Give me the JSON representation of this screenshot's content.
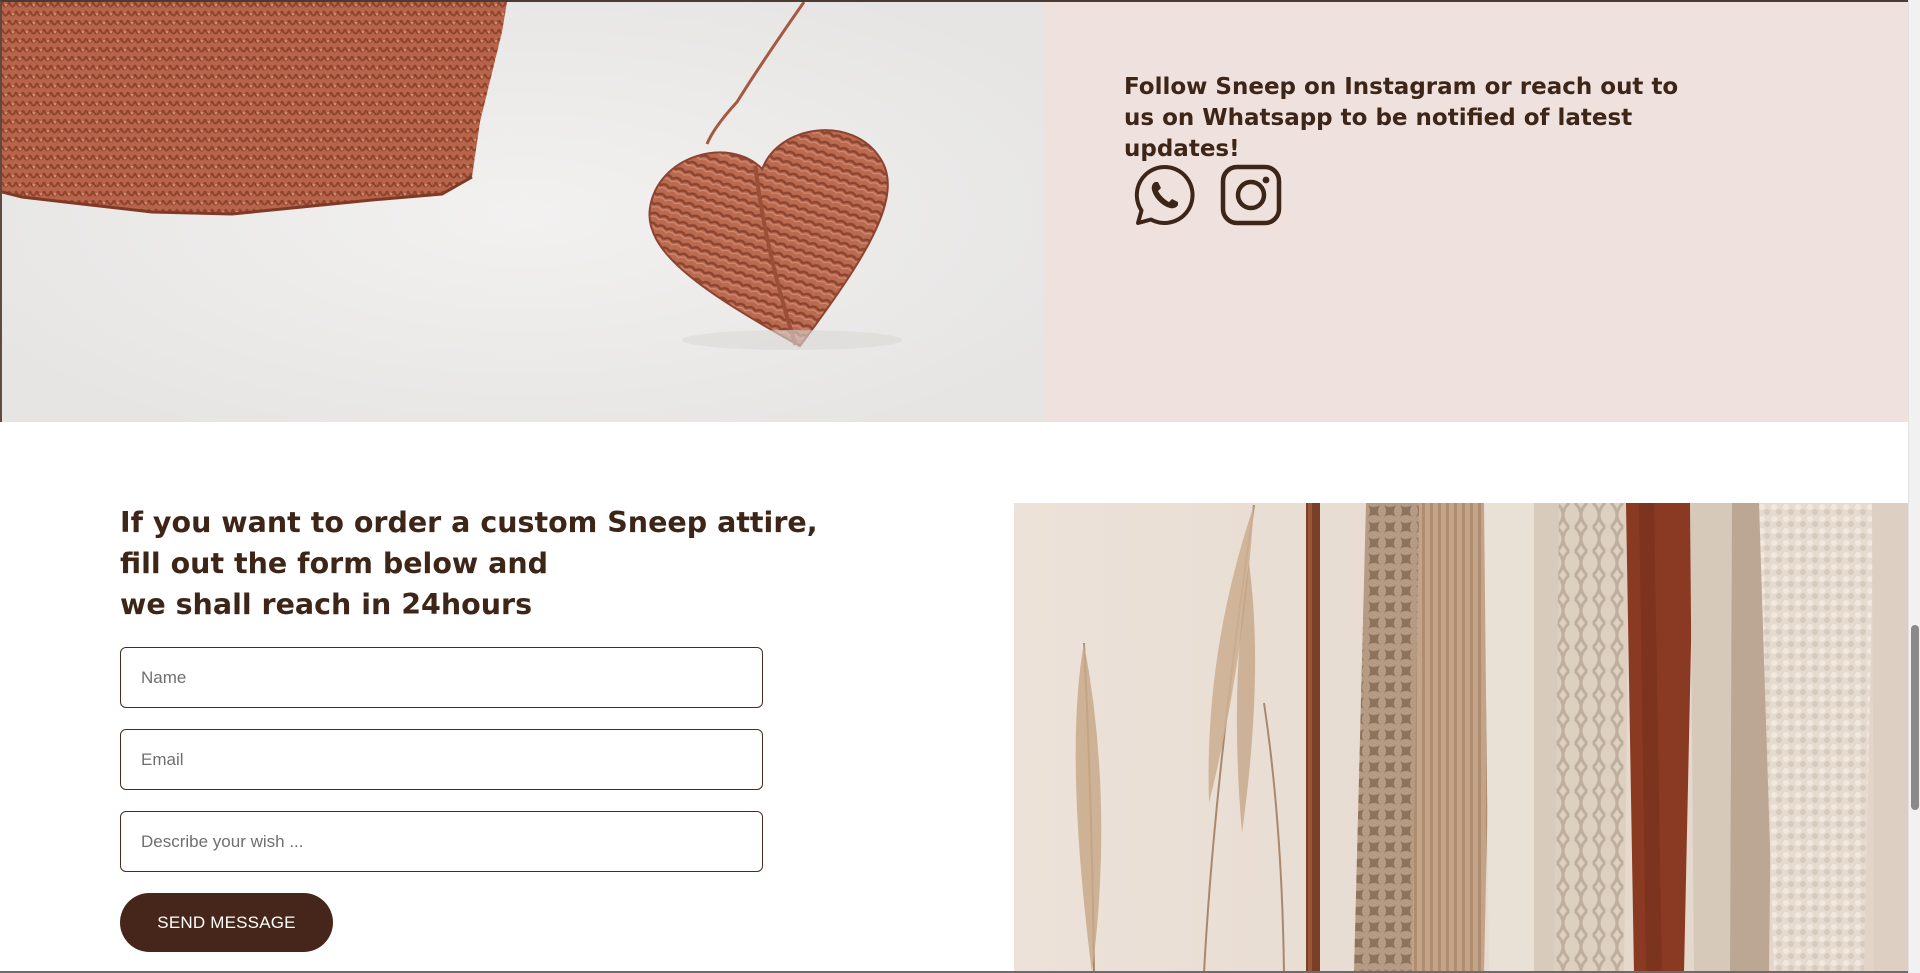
{
  "follow_section": {
    "text": "Follow Sneep on Instagram or reach out to us on Whatsapp to be notified of latest updates!",
    "icons": [
      "whatsapp-icon",
      "instagram-icon"
    ],
    "icon_color": "#3d2518",
    "background_color": "#efe2de"
  },
  "order_section": {
    "heading_lines": [
      "If you want to order a custom Sneep attire,",
      "fill out the form below and",
      "we shall reach in 24hours"
    ],
    "form": {
      "name_placeholder": "Name",
      "email_placeholder": "Email",
      "wish_placeholder": "Describe your wish ...",
      "name_value": "",
      "email_value": "",
      "wish_value": "",
      "submit_label": "SEND MESSAGE"
    },
    "accent_color": "#46261a"
  }
}
